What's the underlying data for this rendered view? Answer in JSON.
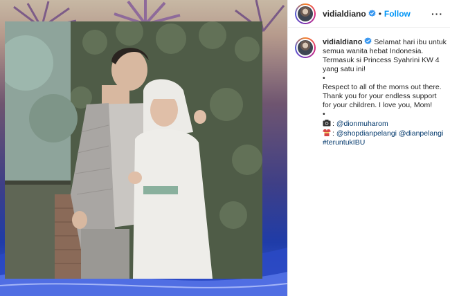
{
  "post": {
    "username": "vidialdiano",
    "follow_label": "Follow",
    "separator": "•",
    "more_label": "···"
  },
  "caption": {
    "username": "vidialdiano",
    "lines": [
      "Selamat hari ibu untuk",
      "semua wanita hebat Indonesia.",
      "Termasuk si Princess Syahrini KW 4",
      "yang satu ini!",
      "•",
      "Respect to all of the moms out there.",
      "Thank you for your endless support",
      "for your children. I love you, Mom!",
      "•"
    ],
    "credit_photo": {
      "prefix": ": ",
      "mention": "@dionmuharom"
    },
    "credit_outfit": {
      "prefix": ": ",
      "mention1": "@shopdianpelangi",
      "mention2": "@dianpelangi"
    },
    "hashtag": "#teruntukIBU"
  },
  "icons": {
    "verified": "verified-badge-icon",
    "camera": "camera-emoji-icon",
    "dress": "kimono-emoji-icon",
    "more": "more-options-icon"
  },
  "colors": {
    "follow": "#0095f6",
    "verified": "#3897f0",
    "mention": "#00376b"
  }
}
